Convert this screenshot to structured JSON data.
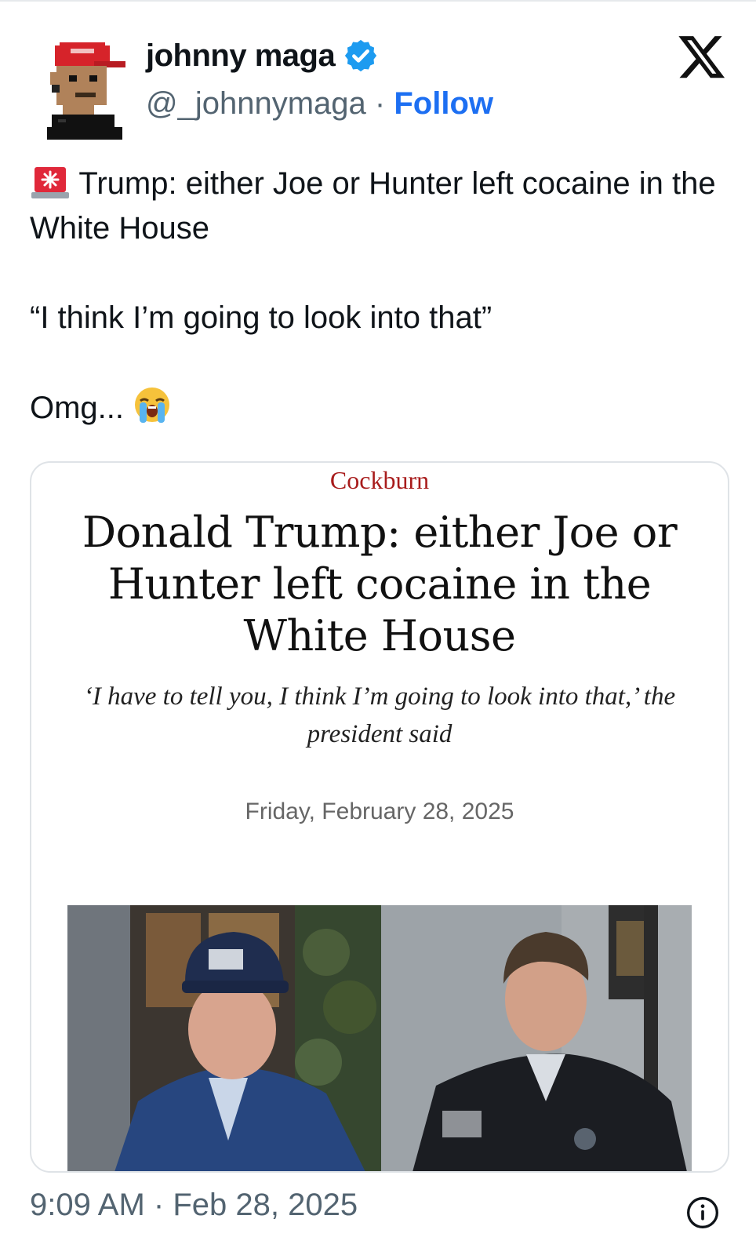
{
  "author": {
    "display_name": "johnny maga",
    "handle": "@_johnnymaga",
    "separator": "·",
    "follow_label": "Follow",
    "verified": true,
    "avatar_icon": "pixel-avatar-red-cap-icon",
    "verified_icon": "verified-badge-icon"
  },
  "platform_icon": "x-logo-icon",
  "tweet": {
    "line1_emoji_icon": "siren-emoji-icon",
    "line1": "Trump: either Joe or Hunter left cocaine in the White House",
    "line2": "“I think I’m going to look into that”",
    "line3": "Omg...",
    "line3_emoji_icon": "loudly-crying-face-emoji-icon"
  },
  "card": {
    "source": "Cockburn",
    "headline": "Donald Trump: either Joe or Hunter left cocaine in the White House",
    "standfirst": "‘I have to tell you, I think I’m going to look into that,’ the president said",
    "date": "Friday, February 28, 2025"
  },
  "footer": {
    "time": "9:09 AM",
    "separator": "·",
    "date": "Feb 28, 2025",
    "info_icon": "info-circle-icon"
  },
  "colors": {
    "follow": "#1d6ff2",
    "verified": "#1d9bf0",
    "source_red": "#a81c1c",
    "secondary_text": "#536471"
  }
}
